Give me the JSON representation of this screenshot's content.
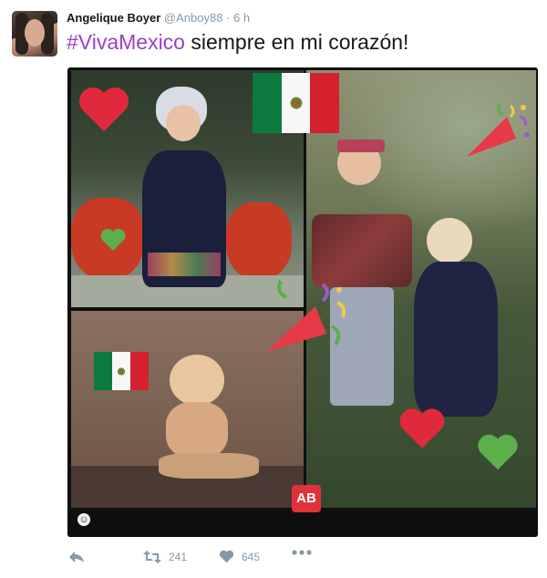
{
  "author": {
    "name": "Angelique Boyer",
    "handle": "@Anboy88",
    "separator": "·",
    "time": "6 h"
  },
  "tweet": {
    "hashtag": "#VivaMexico",
    "text": " siempre en mi corazón!"
  },
  "media": {
    "badge": "AB",
    "flag_colors": [
      "#0b7a3e",
      "#f7f7f7",
      "#d5202e"
    ]
  },
  "actions": {
    "retweets": "241",
    "likes": "645"
  },
  "colors": {
    "hashtag": "#9b3fc6",
    "meta": "#8899a6",
    "heart_red": "#e02a3b",
    "heart_green": "#5bb04a"
  }
}
